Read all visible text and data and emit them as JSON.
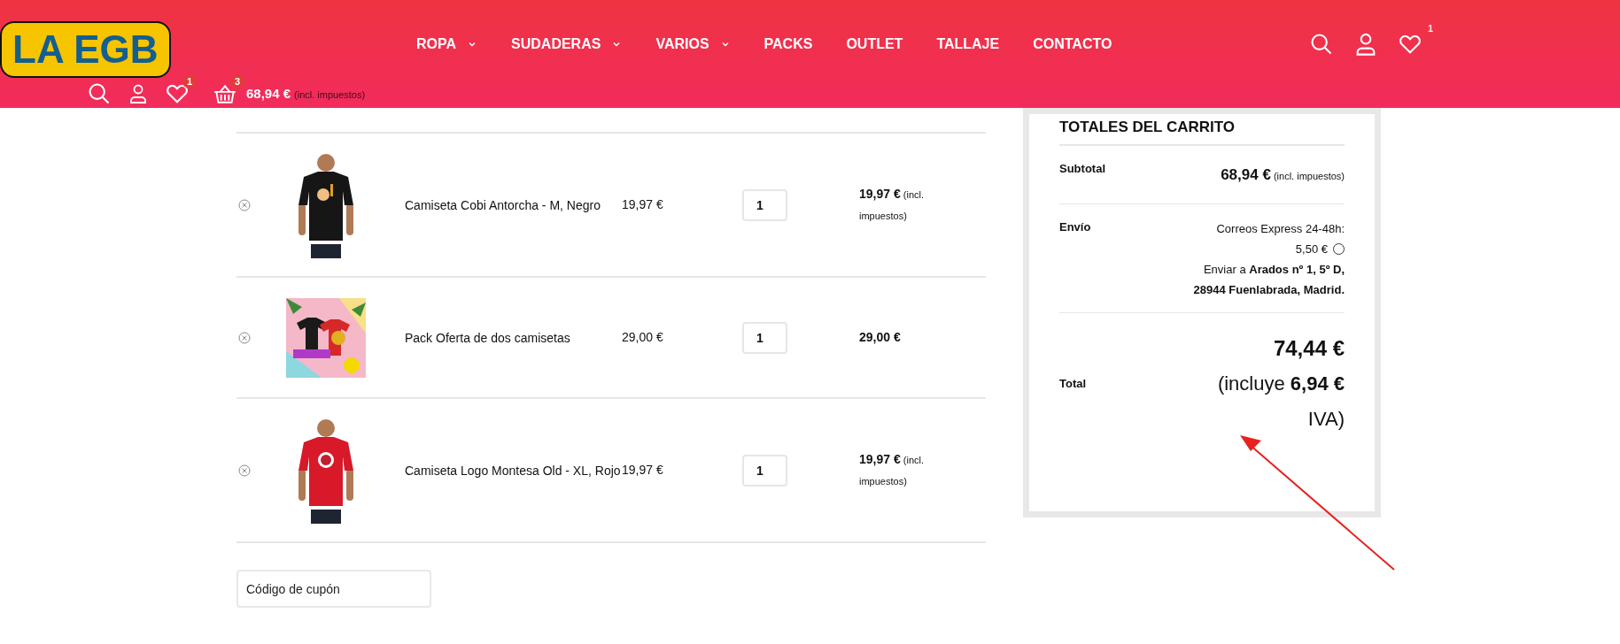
{
  "header": {
    "logo": {
      "text": "LA EGB"
    },
    "nav": [
      {
        "label": "ROPA",
        "dropdown": true
      },
      {
        "label": "SUDADERAS",
        "dropdown": true
      },
      {
        "label": "VARIOS",
        "dropdown": true
      },
      {
        "label": "PACKS",
        "dropdown": false
      },
      {
        "label": "OUTLET",
        "dropdown": false
      },
      {
        "label": "TALLAJE",
        "dropdown": false
      },
      {
        "label": "CONTACTO",
        "dropdown": false
      }
    ],
    "mini_bar": {
      "wishlist_count": "1",
      "cart_count": "3",
      "cart_total": "68,94 €",
      "cart_note": "(incl. impuestos)"
    },
    "right_icons": {
      "wishlist_count": "1"
    }
  },
  "cart": {
    "rows": [
      {
        "product": "Camiseta Cobi Antorcha - M, Negro",
        "price": "19,97 €",
        "quantity": "1",
        "subtotal": "19,97 €",
        "subtotal_note": "(incl. impuestos)"
      },
      {
        "product": "Pack Oferta de dos camisetas",
        "price": "29,00 €",
        "quantity": "1",
        "subtotal": "29,00 €"
      },
      {
        "product": "Camiseta Logo Montesa Old - XL, Rojo",
        "price": "19,97 €",
        "quantity": "1",
        "subtotal": "19,97 €",
        "subtotal_note": "(incl. impuestos)"
      }
    ],
    "coupon": {
      "placeholder": "Código de cupón"
    }
  },
  "totals": {
    "title": "TOTALES DEL CARRITO",
    "subtotal_label": "Subtotal",
    "subtotal": "68,94 €",
    "subtotal_note": "(incl. impuestos)",
    "shipping_label": "Envío",
    "shipping_method": "Correos Express 24-48h:",
    "shipping_price": "5,50 €",
    "shipping_selected": false,
    "shipping_address": "Enviar a **Arados nº 1, 5º D, 28944 Fuenlabrada, Madrid.**",
    "total_label": "Total",
    "total": "74,44 €",
    "tax_note": "(incluye **6,94 €** IVA)"
  }
}
